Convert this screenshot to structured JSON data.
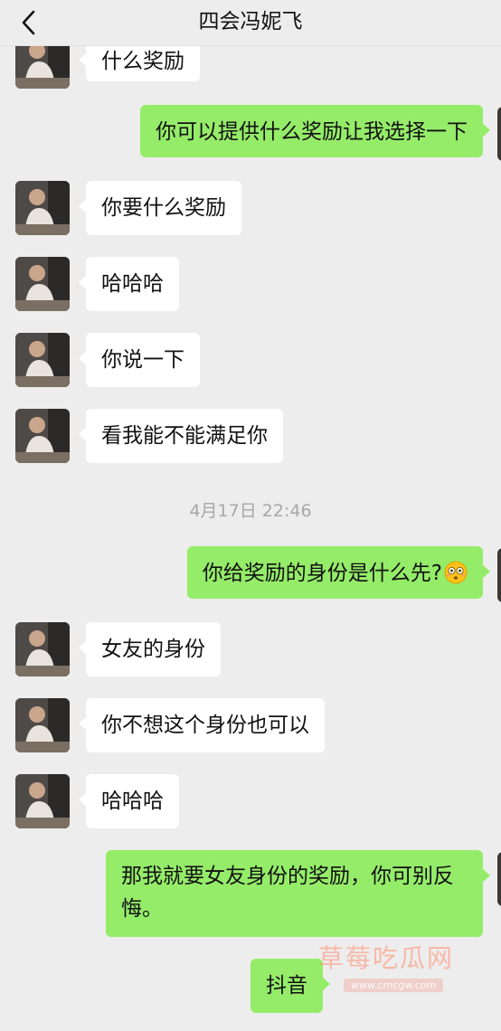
{
  "header": {
    "title": "四会冯妮飞"
  },
  "messages": [
    {
      "text": "什么奖励"
    },
    {
      "text": "你可以提供什么奖励让我选择一下"
    },
    {
      "text": "你要什么奖励"
    },
    {
      "text": "哈哈哈"
    },
    {
      "text": "你说一下"
    },
    {
      "text": "看我能不能满足你"
    },
    {
      "text": "你给奖励的身份是什么先?"
    },
    {
      "text": "女友的身份"
    },
    {
      "text": "你不想这个身份也可以"
    },
    {
      "text": "哈哈哈"
    },
    {
      "text": "那我就要女友身份的奖励，你可别反悔。"
    },
    {
      "text": "抖音"
    }
  ],
  "timestamp": "4月17日 22:46",
  "emoji": "flushed-face",
  "watermark": {
    "text": "草莓吃瓜网",
    "url": "www.cmcgw.com"
  },
  "colors": {
    "background": "#ededed",
    "outgoing_bubble": "#95ec69",
    "incoming_bubble": "#ffffff",
    "timestamp": "#a7a7a7"
  }
}
